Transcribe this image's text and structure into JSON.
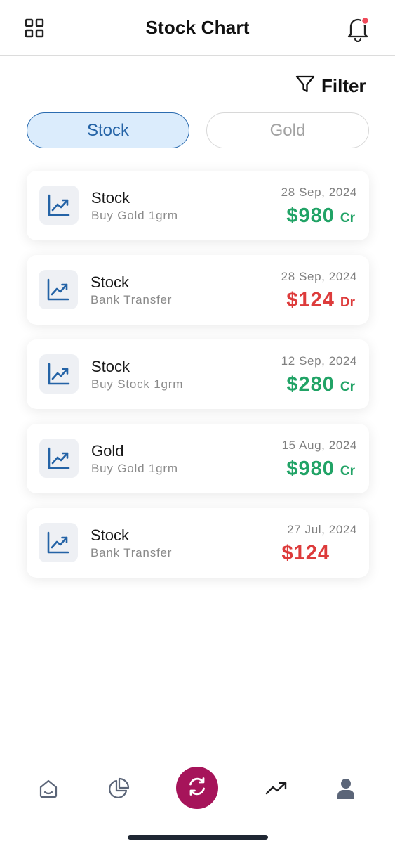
{
  "header": {
    "title": "Stock Chart",
    "menu_icon": "grid-icon",
    "notification_icon": "bell-icon",
    "notification_dot_color": "#f04a5a"
  },
  "filter": {
    "label": "Filter",
    "icon": "filter-icon"
  },
  "tabs": [
    {
      "label": "Stock",
      "active": true
    },
    {
      "label": "Gold",
      "active": false
    }
  ],
  "transactions": [
    {
      "name": "Stock",
      "description": "Buy Gold 1grm",
      "date": "28 Sep, 2024",
      "amount": "$980",
      "type": "Cr",
      "icon": "trending-up-icon"
    },
    {
      "name": "Stock",
      "description": "Bank Transfer",
      "date": "28 Sep, 2024",
      "amount": "$124",
      "type": "Dr",
      "icon": "trending-up-icon"
    },
    {
      "name": "Stock",
      "description": "Buy Stock 1grm",
      "date": "12 Sep, 2024",
      "amount": "$280",
      "type": "Cr",
      "icon": "trending-up-icon"
    },
    {
      "name": "Gold",
      "description": "Buy Gold 1grm",
      "date": "15 Aug, 2024",
      "amount": "$980",
      "type": "Cr",
      "icon": "trending-up-icon"
    },
    {
      "name": "Stock",
      "description": "Bank Transfer",
      "date": "27 Jul, 2024",
      "amount": "$124",
      "type": "",
      "icon": "trending-up-icon"
    }
  ],
  "bottom_nav": {
    "items": [
      "home-icon",
      "pie-chart-icon",
      "refresh-icon",
      "trending-up-icon",
      "user-icon"
    ],
    "accent_color": "#a6145a"
  },
  "colors": {
    "credit": "#21a366",
    "debit": "#dd3b3b",
    "active_tab_bg": "#dbecfc",
    "active_tab_border": "#2b6cb0"
  }
}
